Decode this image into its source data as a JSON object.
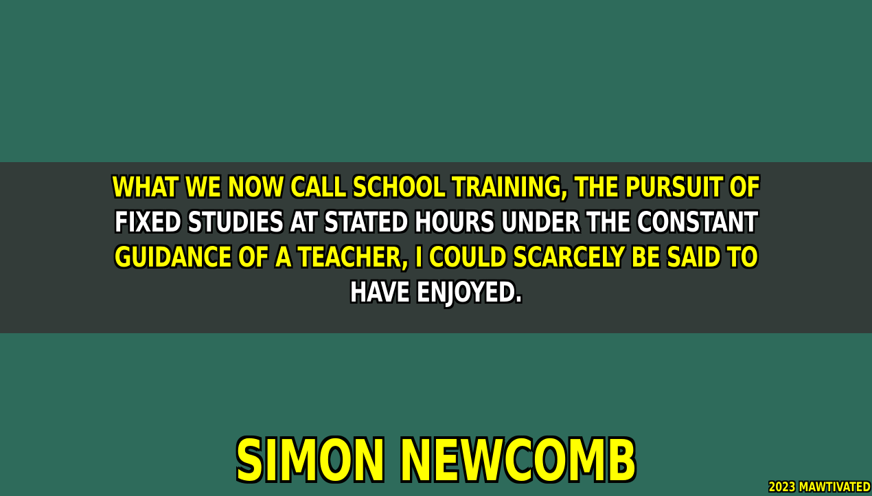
{
  "quote": {
    "lines": [
      "WHAT WE NOW CALL SCHOOL TRAINING, THE PURSUIT OF",
      "FIXED STUDIES AT STATED HOURS UNDER THE CONSTANT",
      "GUIDANCE OF A TEACHER, I COULD SCARCELY BE SAID TO",
      "HAVE ENJOYED."
    ]
  },
  "author": "SIMON NEWCOMB",
  "credit": "2023 MAWTIVATED",
  "colors": {
    "background": "#2e6b5b",
    "band": "#333c39",
    "highlight_text": "#ffff00",
    "plain_text": "#ffffff",
    "outline": "#000000"
  }
}
